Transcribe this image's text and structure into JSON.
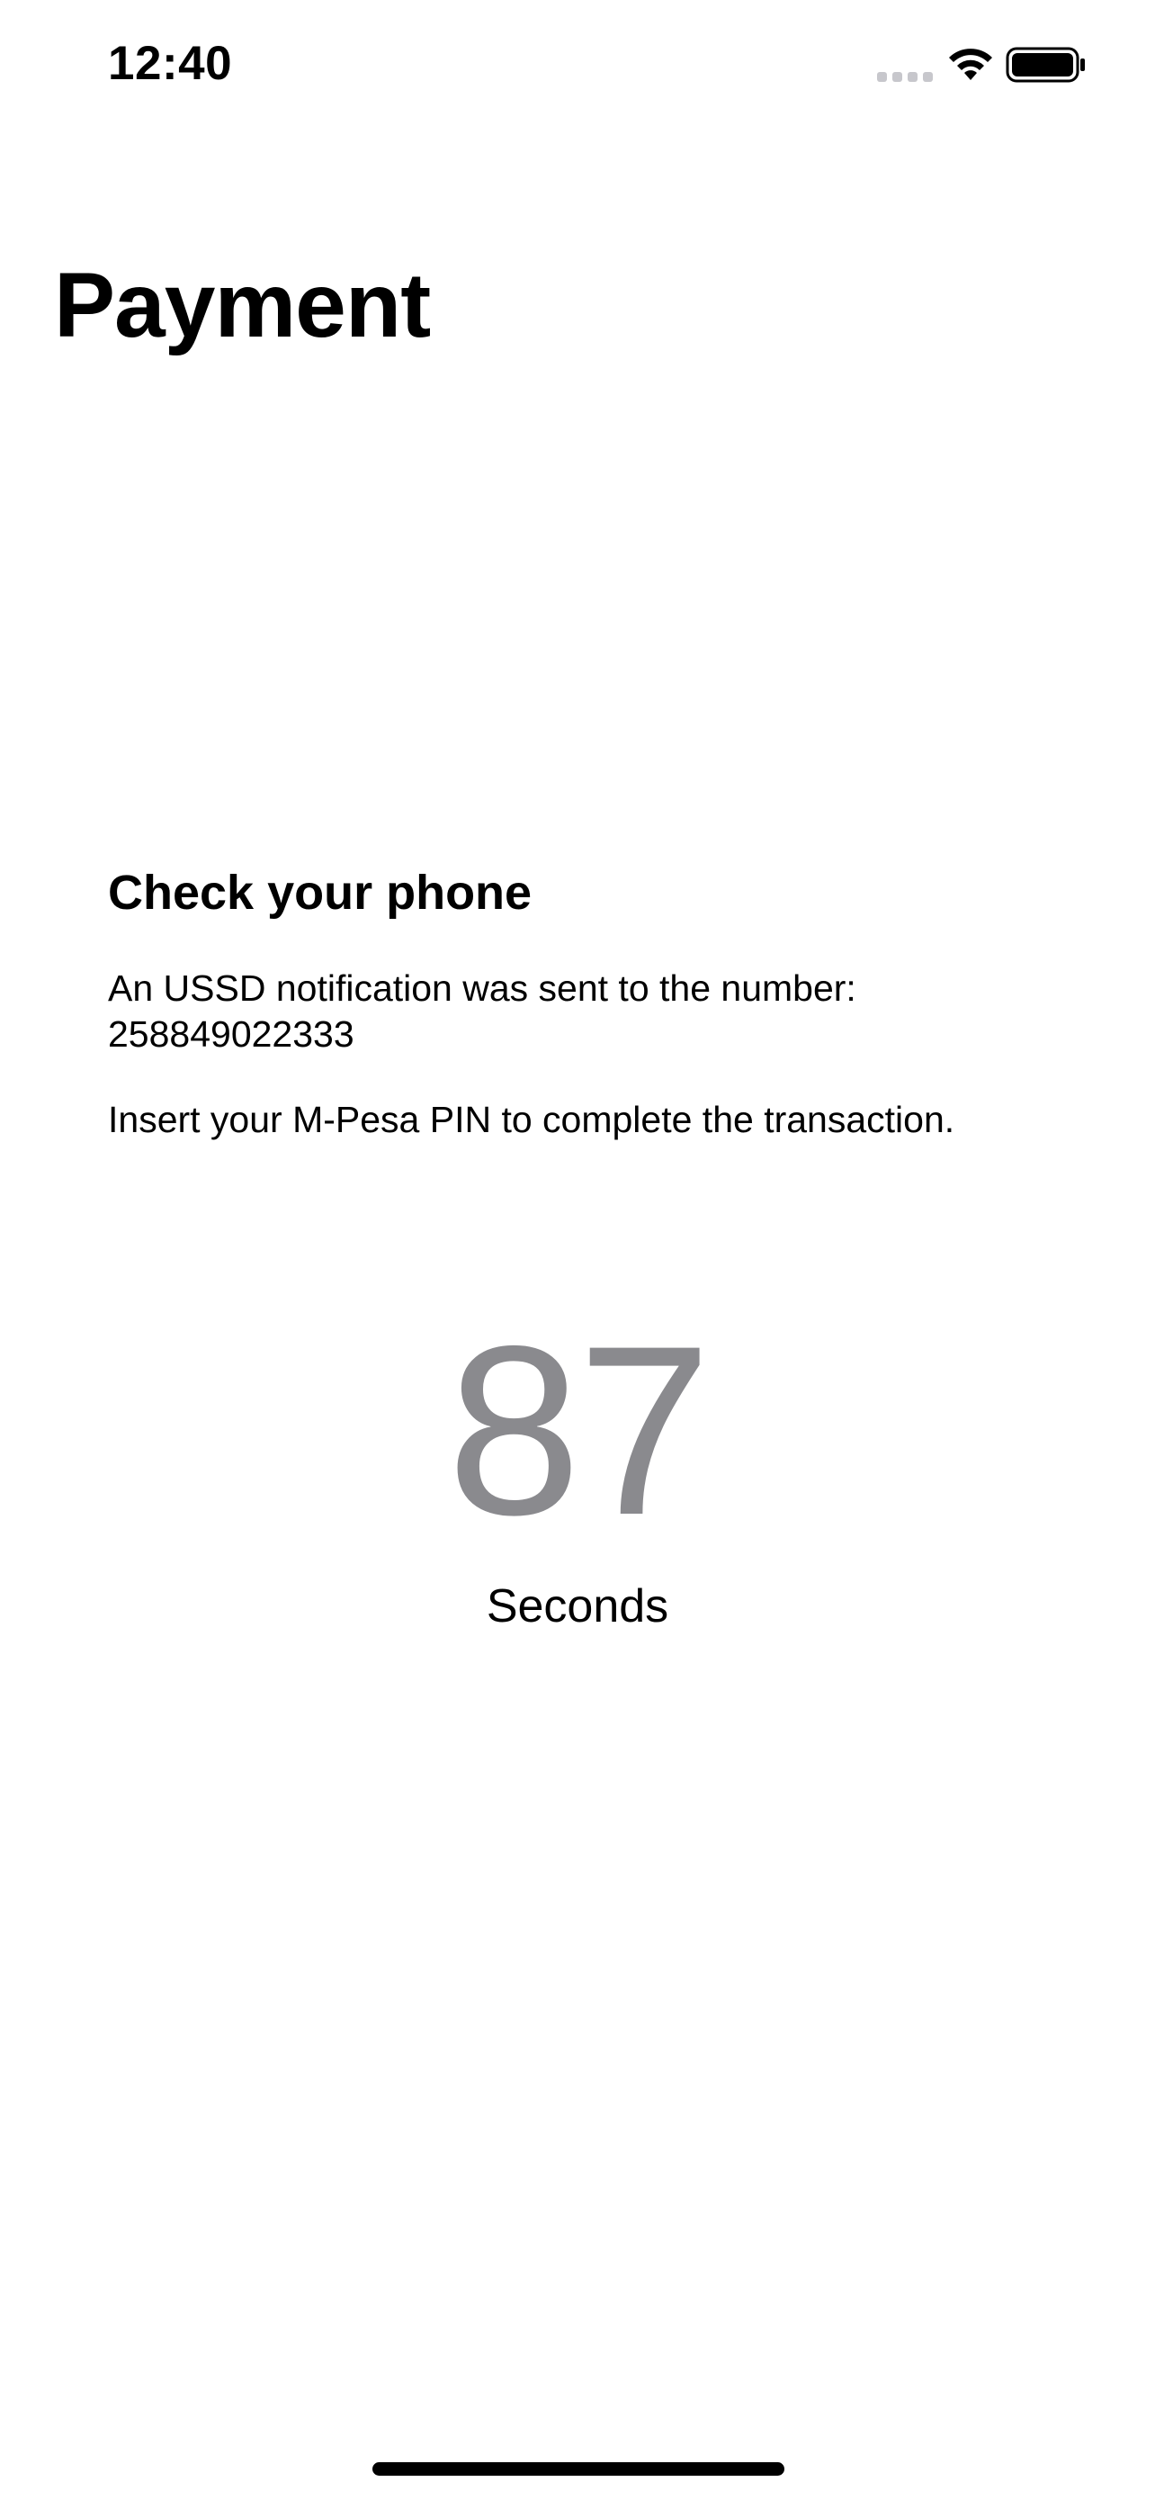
{
  "status_bar": {
    "time": "12:40",
    "icons": [
      "cellular-signal-icon",
      "wifi-icon",
      "battery-icon"
    ]
  },
  "page": {
    "title": "Payment"
  },
  "notice": {
    "heading": "Check your phone",
    "message_line": "An USSD notification was sent to the number:",
    "phone_number": "258849022333",
    "instruction": "Insert your M-Pesa PIN to complete the transaction."
  },
  "countdown": {
    "value": "87",
    "unit": "Seconds",
    "color": "#8a8a8e"
  }
}
